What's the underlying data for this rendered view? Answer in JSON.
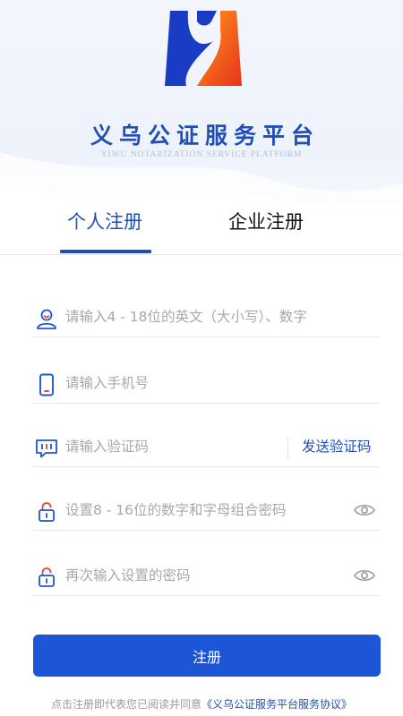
{
  "brand": {
    "title": "义乌公证服务平台",
    "subtitle": "YIWU NOTARIZATION SERVICE PLATFORM",
    "logo_icon": "yiwu-notary-logo-icon"
  },
  "tabs": [
    {
      "label": "个人注册",
      "active": true
    },
    {
      "label": "企业注册",
      "active": false
    }
  ],
  "form": {
    "username": {
      "placeholder": "请输入4 - 18位的英文（大小写）、数字",
      "value": "",
      "icon": "user-icon"
    },
    "phone": {
      "placeholder": "请输入手机号",
      "value": "",
      "icon": "phone-icon"
    },
    "code": {
      "placeholder": "请输入验证码",
      "value": "",
      "icon": "message-code-icon",
      "send_label": "发送验证码"
    },
    "password": {
      "placeholder": "设置8 - 16位的数字和字母组合密码",
      "value": "",
      "icon": "lock-icon"
    },
    "confirm": {
      "placeholder": "再次输入设置的密码",
      "value": "",
      "icon": "lock-icon"
    }
  },
  "submit_label": "注册",
  "agreement": {
    "prefix": "点击注册即代表您已阅读并同意",
    "link": "《义乌公证服务平台服务协议》"
  },
  "colors": {
    "primary": "#1c56d6",
    "tab_active": "#1f4fb6",
    "placeholder": "#a8a8a8",
    "logo_blue": "#1a3bc4",
    "logo_orange": "#f25a1c",
    "icon_red": "#e8452c"
  }
}
